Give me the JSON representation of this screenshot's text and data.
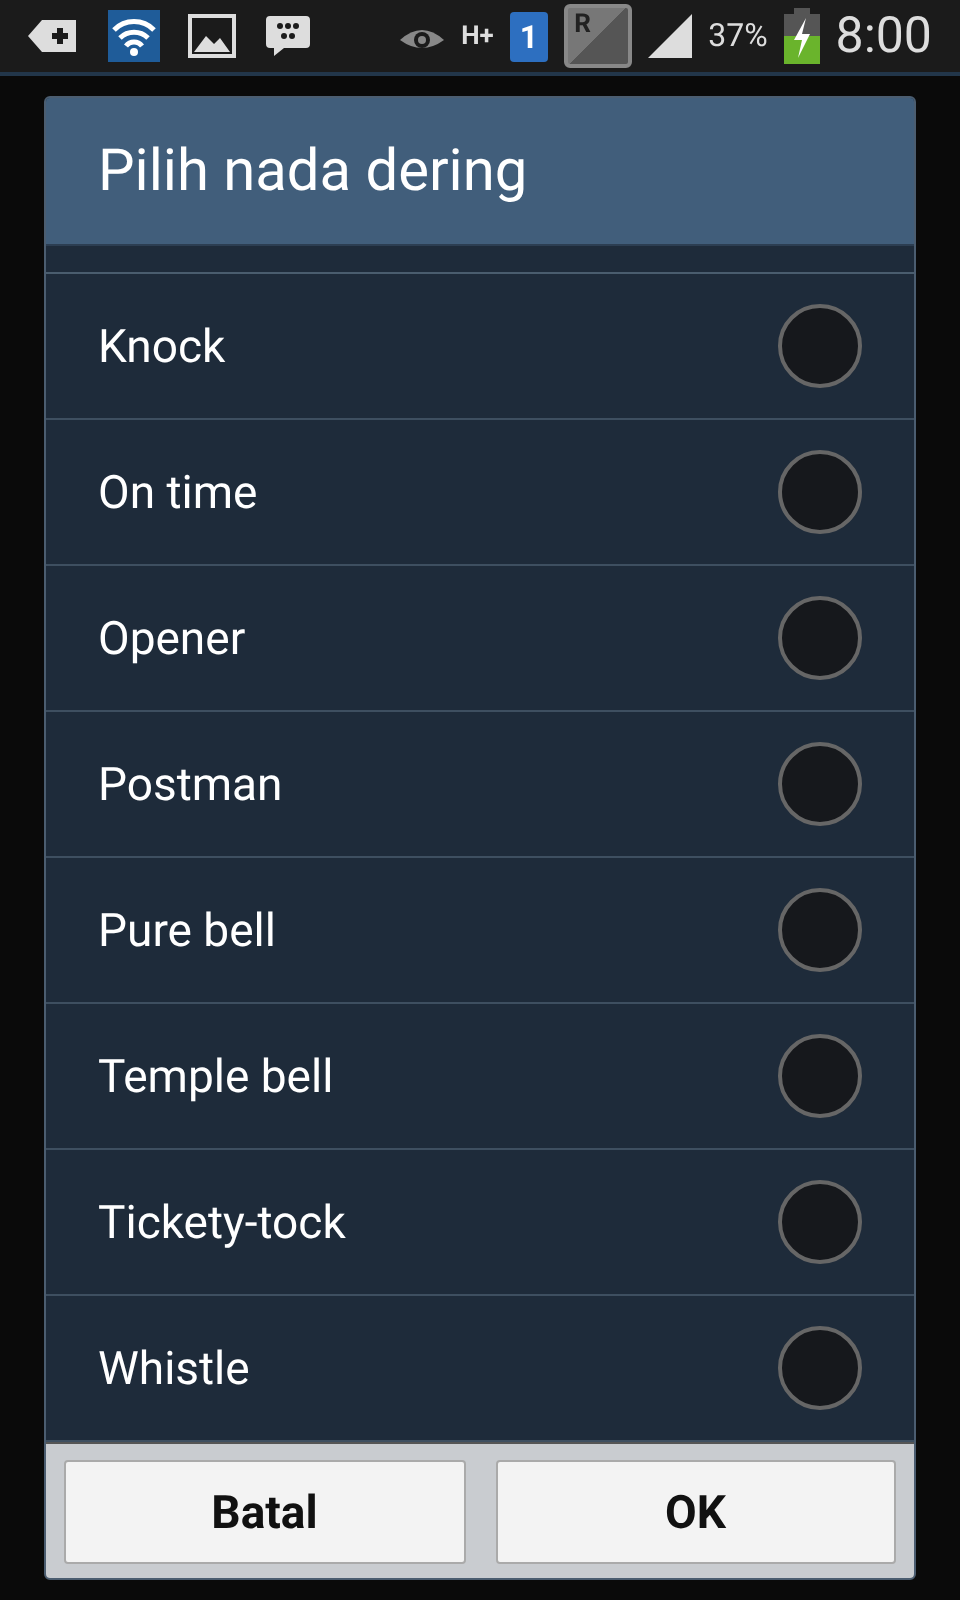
{
  "status_bar": {
    "network_type": "H+",
    "sim_slot": "1",
    "roaming": "R",
    "battery": "37%",
    "time": "8:00"
  },
  "dialog": {
    "title": "Pilih nada dering",
    "options": [
      {
        "label": "Knock",
        "selected": false
      },
      {
        "label": "On time",
        "selected": false
      },
      {
        "label": "Opener",
        "selected": false
      },
      {
        "label": "Postman",
        "selected": false
      },
      {
        "label": "Pure bell",
        "selected": false
      },
      {
        "label": "Temple bell",
        "selected": false
      },
      {
        "label": "Tickety-tock",
        "selected": false
      },
      {
        "label": "Whistle",
        "selected": false
      }
    ],
    "buttons": [
      "Batal",
      "OK"
    ]
  }
}
